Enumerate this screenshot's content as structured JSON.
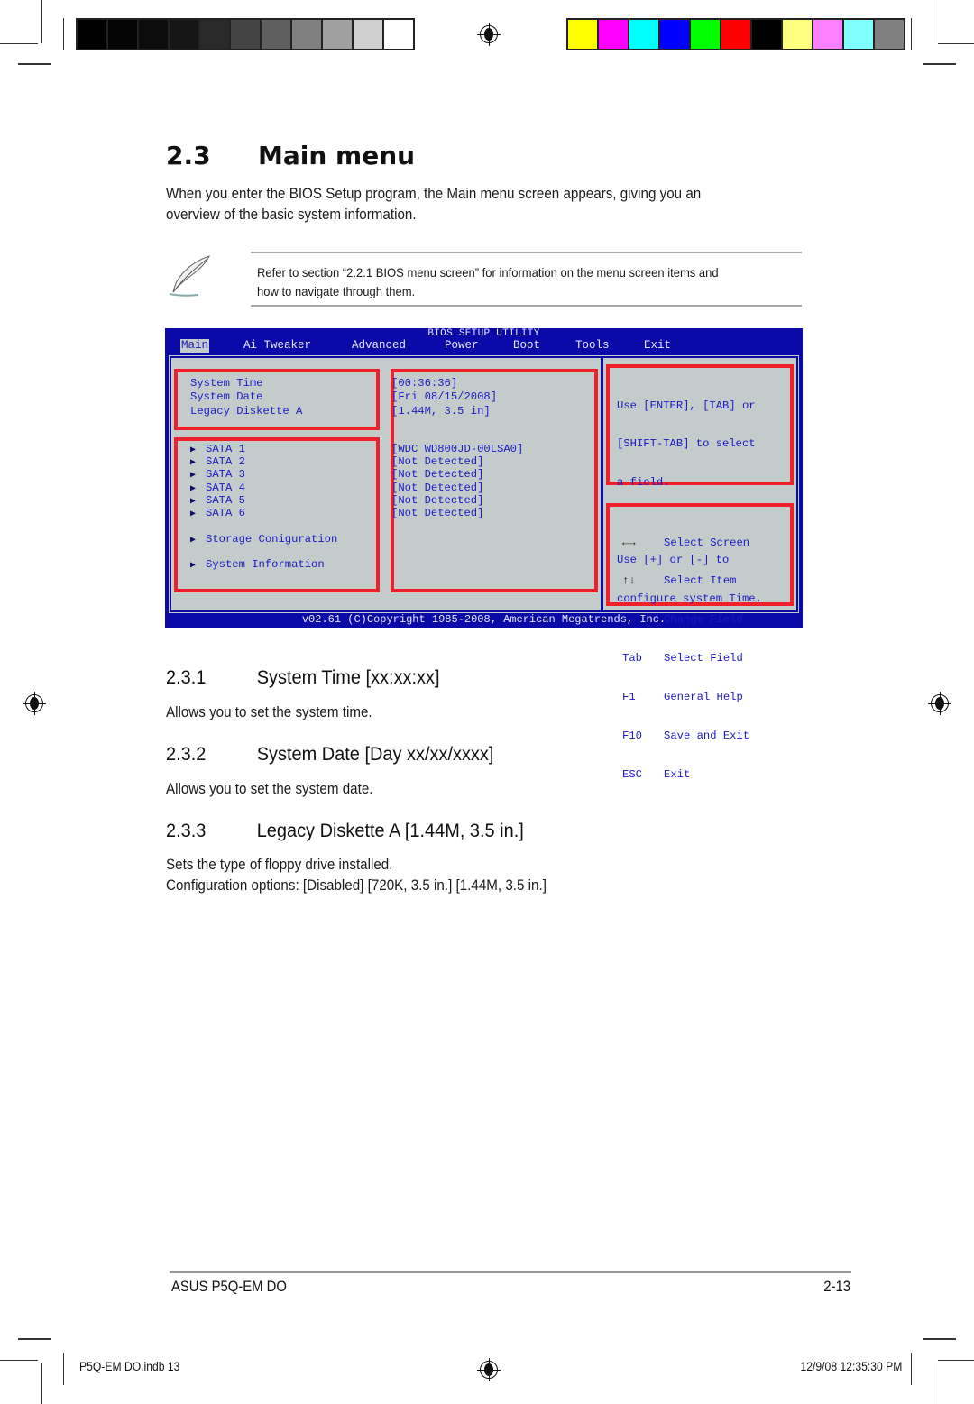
{
  "color_bars": {
    "grayscale": [
      "#000000",
      "#050505",
      "#0c0c0c",
      "#161616",
      "#2a2a2a",
      "#444444",
      "#5f5f5f",
      "#808080",
      "#a0a0a0",
      "#cfcfcf",
      "#ffffff"
    ],
    "colors": [
      "#ffff00",
      "#ff00ff",
      "#00ffff",
      "#0000ff",
      "#00ff00",
      "#ff0000",
      "#000000",
      "#ffff80",
      "#ff80ff",
      "#80ffff",
      "#808080"
    ]
  },
  "section": {
    "number": "2.3",
    "title": "Main menu",
    "intro_line1": "When you enter the BIOS Setup program, the Main menu screen appears, giving you an",
    "intro_line2": "overview of the basic system information."
  },
  "note": {
    "icon": "quill-note-icon",
    "line1": "Refer to section “2.2.1  BIOS menu screen” for information on the menu screen items and",
    "line2": "how to navigate through them."
  },
  "bios": {
    "title": "BIOS SETUP UTILITY",
    "menu": [
      "Main",
      "Ai Tweaker",
      "Advanced",
      "Power",
      "Boot",
      "Tools",
      "Exit"
    ],
    "active_menu": "Main",
    "items_top": [
      "System Time",
      "System Date",
      "Legacy Diskette A"
    ],
    "values_top": [
      "[00:36:36]",
      "[Fri 08/15/2008]",
      "[1.44M, 3.5 in]"
    ],
    "sata_items": [
      "SATA 1",
      "SATA 2",
      "SATA 3",
      "SATA 4",
      "SATA 5",
      "SATA 6"
    ],
    "sata_values": [
      "[WDC WD800JD-00LSA0]",
      "[Not Detected]",
      "[Not Detected]",
      "[Not Detected]",
      "[Not Detected]",
      "[Not Detected]"
    ],
    "submenus": [
      "Storage Coniguration",
      "System Information"
    ],
    "help": [
      "Use [ENTER], [TAB] or",
      "[SHIFT-TAB] to select",
      "a field.",
      "",
      "Use [+] or [-] to",
      "configure system Time."
    ],
    "keys": [
      {
        "key": "←→",
        "action": "Select Screen"
      },
      {
        "key": "↑↓",
        "action": "Select Item"
      },
      {
        "key": "+-",
        "action": "Change Field"
      },
      {
        "key": "Tab",
        "action": "Select Field"
      },
      {
        "key": "F1",
        "action": "General Help"
      },
      {
        "key": "F10",
        "action": "Save and Exit"
      },
      {
        "key": "ESC",
        "action": "Exit"
      }
    ],
    "footer": "v02.61 (C)Copyright 1985-2008, American Megatrends, Inc."
  },
  "subsections": [
    {
      "number": "2.3.1",
      "title": "System Time [xx:xx:xx]",
      "body": [
        "Allows you to set the system time."
      ]
    },
    {
      "number": "2.3.2",
      "title": "System Date [Day xx/xx/xxxx]",
      "body": [
        "Allows you to set the system date."
      ]
    },
    {
      "number": "2.3.3",
      "title": "Legacy Diskette A [1.44M, 3.5 in.]",
      "body": [
        "Sets the type of floppy drive installed.",
        "Configuration options: [Disabled] [720K, 3.5 in.] [1.44M, 3.5 in.]"
      ]
    }
  ],
  "page_footer": {
    "product": "ASUS P5Q-EM DO",
    "page": "2-13"
  },
  "slug": {
    "file": "P5Q-EM DO.indb   13",
    "timestamp": "12/9/08   12:35:30 PM"
  }
}
